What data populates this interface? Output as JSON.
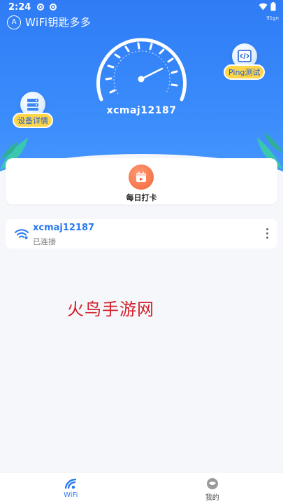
{
  "status_bar": {
    "time": "2:24",
    "network_badge": "91gn"
  },
  "header": {
    "app_name": "WiFi钥匙多多",
    "logo_letter": "A"
  },
  "speed_panel": {
    "ssid": "xcmaj12187"
  },
  "quick_actions": {
    "device_details": "设备详情",
    "ping_test": "Ping测试"
  },
  "checkin": {
    "label": "每日打卡"
  },
  "wifi_list": [
    {
      "ssid": "xcmaj12187",
      "status": "已连接"
    }
  ],
  "watermark": "火鸟手游网",
  "tab_bar": {
    "tabs": [
      {
        "label": "WiFi",
        "active": true
      },
      {
        "label": "我的",
        "active": false
      }
    ]
  },
  "colors": {
    "primary": "#2f7cf6",
    "accent_yellow": "#ffd54a",
    "checkin_orange": "#f2653a",
    "watermark_red": "#d2202a",
    "leaf_teal": "#39c7b0"
  },
  "icons": [
    "speed-gauge-icon",
    "device-server-icon",
    "code-icon",
    "calendar-icon",
    "wifi-icon",
    "more-vert-icon",
    "profile-icon"
  ]
}
